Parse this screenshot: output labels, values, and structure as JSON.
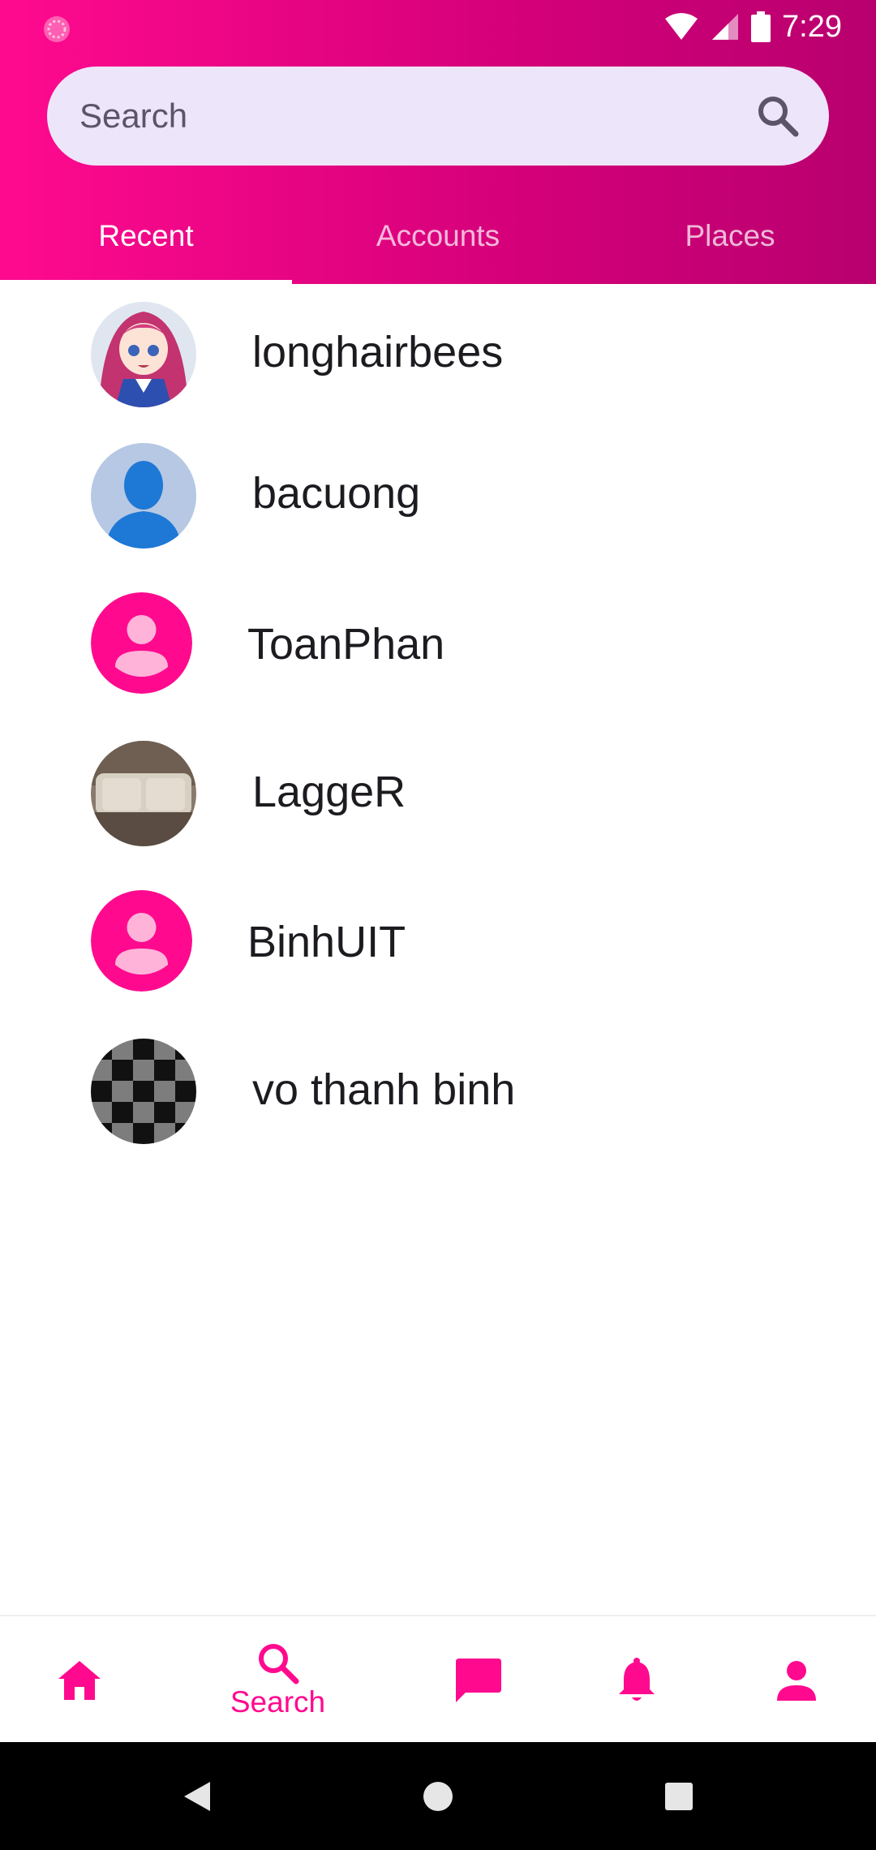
{
  "status_bar": {
    "time": "7:29"
  },
  "search": {
    "placeholder": "Search"
  },
  "tabs": [
    {
      "label": "Recent",
      "active": true
    },
    {
      "label": "Accounts",
      "active": false
    },
    {
      "label": "Places",
      "active": false
    }
  ],
  "results": [
    {
      "name": "longhairbees",
      "avatar": "anime-character-photo"
    },
    {
      "name": "bacuong",
      "avatar": "default-silhouette"
    },
    {
      "name": "ToanPhan",
      "avatar": "person-placeholder-icon"
    },
    {
      "name": "LaggeR",
      "avatar": "sofa-photo"
    },
    {
      "name": "BinhUIT",
      "avatar": "person-placeholder-icon"
    },
    {
      "name": "vo thanh binh",
      "avatar": "checkerboard-pattern"
    }
  ],
  "bottom_nav": {
    "items": [
      {
        "icon": "home-icon",
        "label": ""
      },
      {
        "icon": "search-icon",
        "label": "Search",
        "active": true
      },
      {
        "icon": "chat-icon",
        "label": ""
      },
      {
        "icon": "bell-icon",
        "label": ""
      },
      {
        "icon": "person-icon",
        "label": ""
      }
    ]
  },
  "colors": {
    "accent": "#ff0a8f",
    "header_gradient_start": "#ff0a8f",
    "header_gradient_end": "#b8006e",
    "search_background": "#ede6fb"
  }
}
